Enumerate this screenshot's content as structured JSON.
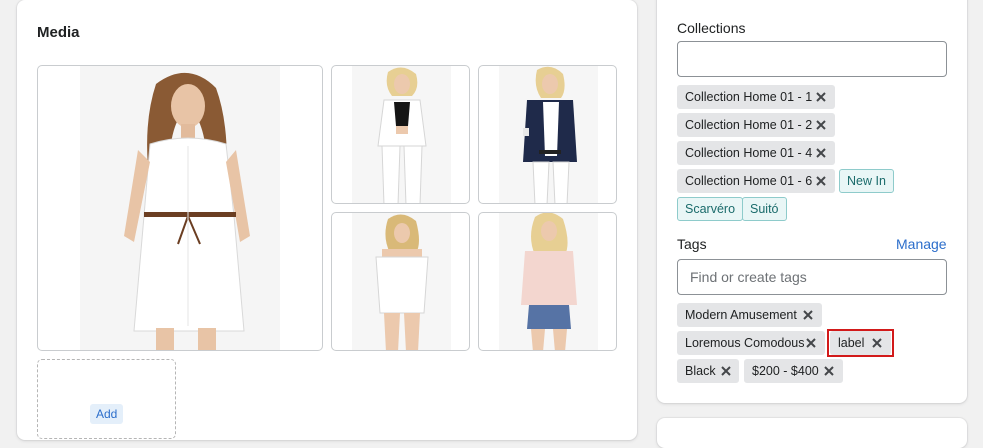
{
  "media": {
    "title": "Media",
    "add_label": "Add",
    "images": [
      {
        "name": "white-belted-shirt-dress"
      },
      {
        "name": "white-trouser-suit"
      },
      {
        "name": "navy-blazer-white-jeans"
      },
      {
        "name": "white-off-shoulder-playsuit"
      },
      {
        "name": "pink-tee-denim-shorts"
      }
    ]
  },
  "collections": {
    "label": "Collections",
    "input_value": "",
    "chips": [
      {
        "label": "Collection Home 01 - 1",
        "removable": true
      },
      {
        "label": "Collection Home 01 - 2",
        "removable": true
      },
      {
        "label": "Collection Home 01 - 4",
        "removable": true
      },
      {
        "label": "Collection Home 01 - 6",
        "removable": true
      },
      {
        "label": "New In",
        "removable": false
      },
      {
        "label": "Scarvéro",
        "removable": false
      },
      {
        "label": "Suitó",
        "removable": false
      }
    ]
  },
  "tags": {
    "label": "Tags",
    "manage_label": "Manage",
    "input_placeholder": "Find or create tags",
    "items": [
      {
        "label": "Modern Amusement"
      },
      {
        "label": "Loremous Comodous"
      },
      {
        "label": "label"
      },
      {
        "label": "Black"
      },
      {
        "label": "$200 - $400"
      }
    ]
  },
  "colors": {
    "accent": "#2c6ecb",
    "tag_bg": "#e4e5e7",
    "teal_border": "#8ecbcb",
    "highlight": "#d21a1a"
  }
}
